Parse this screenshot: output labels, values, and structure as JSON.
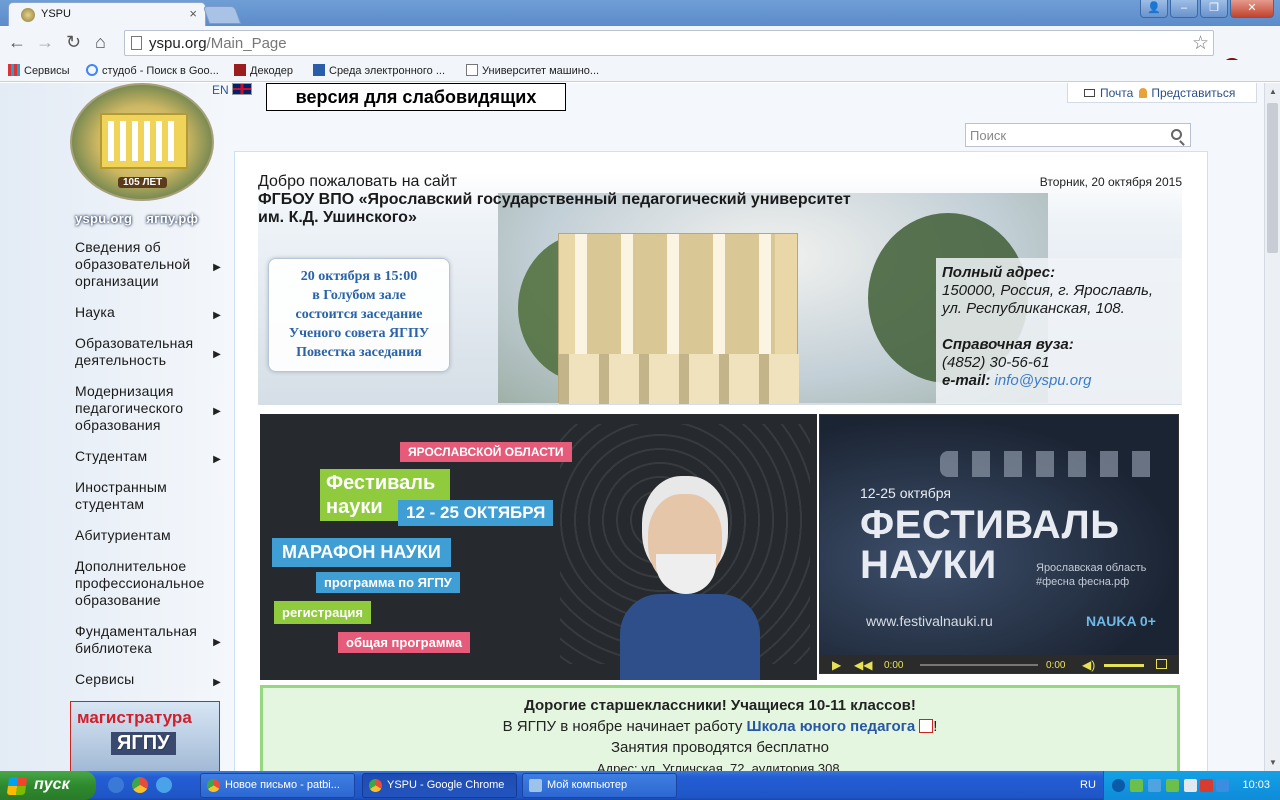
{
  "browser": {
    "tab_title": "YSPU",
    "url_domain": "yspu.org",
    "url_path": "/Main_Page",
    "bookmarks": [
      "Сервисы",
      "студоб - Поиск в Goo...",
      "Декодер",
      "Среда электронного ...",
      "Университет машино..."
    ]
  },
  "page": {
    "lang": "EN",
    "low_vision": "версия для слабовидящих",
    "mail": "Почта",
    "login": "Представиться",
    "search_placeholder": "Поиск",
    "logo_years": "105 ЛЕТ",
    "site_link_1": "yspu.org",
    "site_link_2": "ягпу.рф",
    "menu": [
      {
        "label": "Сведения об образовательной организации",
        "submenu": true
      },
      {
        "label": "Наука",
        "submenu": true
      },
      {
        "label": "Образовательная деятельность",
        "submenu": true
      },
      {
        "label": "Модернизация педагогического образования",
        "submenu": true
      },
      {
        "label": "Студентам",
        "submenu": true
      },
      {
        "label": "Иностранным студентам",
        "submenu": false
      },
      {
        "label": "Абитуриентам",
        "submenu": false
      },
      {
        "label": "Дополнительное профессиональное образование",
        "submenu": false
      },
      {
        "label": "Фундаментальная библиотека",
        "submenu": true
      },
      {
        "label": "Сервисы",
        "submenu": true
      }
    ],
    "magistr_1": "магистратура",
    "magistr_2": "ЯГПУ",
    "welcome_1": "Добро пожаловать на сайт",
    "welcome_2": "ФГБОУ ВПО «Ярославский государственный педагогический университет",
    "welcome_3": "им. К.Д. Ушинского»",
    "date": "Вторник, 20 октября 2015",
    "notice": [
      "20 октября в 15:00",
      "в Голубом зале",
      "состоится заседание",
      "Ученого совета ЯГПУ",
      "Повестка заседания"
    ],
    "address_label": "Полный адрес:",
    "address_1": "150000, Россия, г. Ярославль,",
    "address_2": "ул. Республиканская, 108.",
    "phone_label": "Справочная вуза:",
    "phone": "(4852) 30-56-61",
    "email_label": "e-mail:",
    "email": "info@yspu.org",
    "festival": {
      "region": "ЯРОСЛАВСКОЙ ОБЛАСТИ",
      "festival": "Фестиваль науки",
      "dates": "12 - 25 ОКТЯБРЯ",
      "marathon": "МАРАФОН НАУКИ",
      "program_yspu": "программа по ЯГПУ",
      "registration": "регистрация",
      "general_program": "общая программа"
    },
    "video": {
      "dates": "12-25 октября",
      "title_1": "ФЕСТИВАЛЬ",
      "title_2": "НАУКИ",
      "sub_1": "Ярославская область",
      "sub_2": "#фесна фесна.рф",
      "site": "www.festivalnauki.ru",
      "brand": "NAUKA 0+",
      "time_current": "0:00",
      "time_total": "0:00"
    },
    "announce": {
      "line1": "Дорогие старшеклассники! Учащиеся 10-11 классов!",
      "line2_pre": "В ЯГПУ в ноябре начинает работу",
      "line2_link": "Школа юного педагога",
      "line2_post": "!",
      "line3": "Занятия проводятся бесплатно",
      "line4": "Адрес: ул. Угличская, 72, аудитория 308."
    }
  },
  "taskbar": {
    "start": "пуск",
    "items": [
      "Новое письмо - patbi...",
      "YSPU - Google Chrome",
      "Мой компьютер"
    ],
    "lang": "RU",
    "clock": "10:03"
  }
}
